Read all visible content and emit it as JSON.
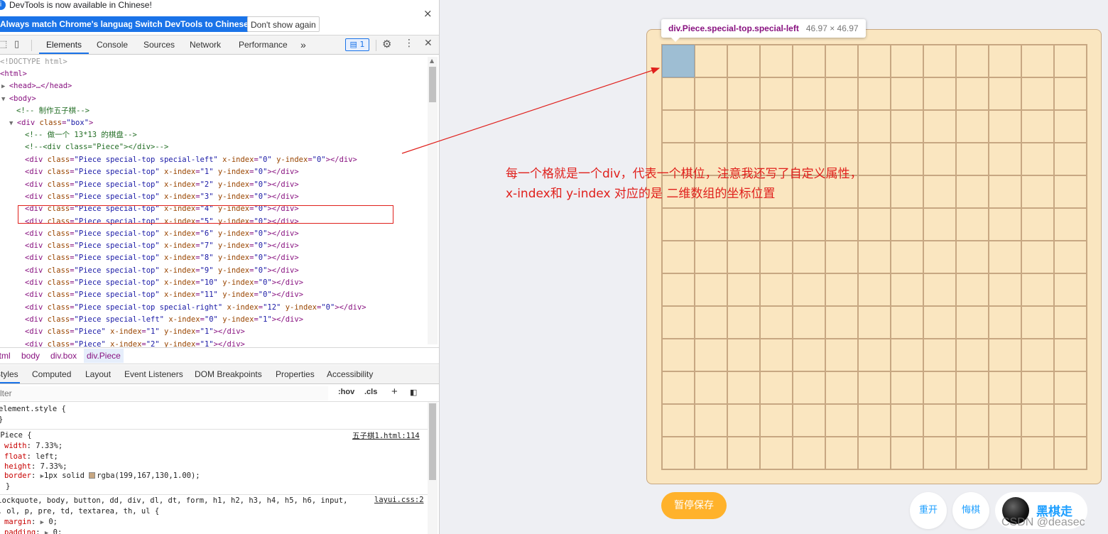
{
  "devtools": {
    "infobar": {
      "message": "DevTools is now available in Chinese!",
      "btn_match": "Always match Chrome's language",
      "btn_switch": "Switch DevTools to Chinese",
      "btn_dont_show": "Don't show again",
      "close": "×"
    },
    "tabs": [
      "Elements",
      "Console",
      "Sources",
      "Network",
      "Performance"
    ],
    "more_tabs": "»",
    "issues_count": "1",
    "dom": {
      "doctype": "<!DOCTYPE html>",
      "html_open": "<html>",
      "head": "<head>…</head>",
      "body_open": "<body>",
      "comment_make": "<!-- 制作五子棋-->",
      "box_tag": "div",
      "box_attr": "class",
      "box_val": "\"box\"",
      "comment_board": "<!-- 做一个 13*13 的棋盘-->",
      "comment_piece": "<!--<div class=\"Piece\"></div>-->",
      "rows": [
        {
          "cls": "\"Piece special-top special-left\"",
          "x": "\"0\"",
          "y": "\"0\""
        },
        {
          "cls": "\"Piece special-top\"",
          "x": "\"1\"",
          "y": "\"0\""
        },
        {
          "cls": "\"Piece special-top\"",
          "x": "\"2\"",
          "y": "\"0\""
        },
        {
          "cls": "\"Piece special-top\"",
          "x": "\"3\"",
          "y": "\"0\""
        },
        {
          "cls": "\"Piece special-top\"",
          "x": "\"4\"",
          "y": "\"0\""
        },
        {
          "cls": "\"Piece special-top\"",
          "x": "\"5\"",
          "y": "\"0\""
        },
        {
          "cls": "\"Piece special-top\"",
          "x": "\"6\"",
          "y": "\"0\""
        },
        {
          "cls": "\"Piece special-top\"",
          "x": "\"7\"",
          "y": "\"0\""
        },
        {
          "cls": "\"Piece special-top\"",
          "x": "\"8\"",
          "y": "\"0\""
        },
        {
          "cls": "\"Piece special-top\"",
          "x": "\"9\"",
          "y": "\"0\""
        },
        {
          "cls": "\"Piece special-top\"",
          "x": "\"10\"",
          "y": "\"0\""
        },
        {
          "cls": "\"Piece special-top\"",
          "x": "\"11\"",
          "y": "\"0\""
        },
        {
          "cls": "\"Piece special-top special-right\"",
          "x": "\"12\"",
          "y": "\"0\""
        },
        {
          "cls": "\"Piece special-left\"",
          "x": "\"0\"",
          "y": "\"1\""
        },
        {
          "cls": "\"Piece\"",
          "x": "\"1\"",
          "y": "\"1\""
        },
        {
          "cls": "\"Piece\"",
          "x": "\"2\"",
          "y": "\"1\""
        }
      ]
    },
    "breadcrumbs": [
      "html",
      "body",
      "div.box",
      "div.Piece"
    ],
    "subtabs": [
      "Styles",
      "Computed",
      "Layout",
      "Event Listeners",
      "DOM Breakpoints",
      "Properties",
      "Accessibility"
    ],
    "filter_placeholder": "Filter",
    "hov": ":hov",
    "cls": ".cls",
    "plus": "+",
    "styles": {
      "element_style": "element.style {",
      "piece_selector": ".Piece {",
      "piece_source": "五子棋1.html:114",
      "props": [
        {
          "name": "width",
          "value": "7.33%;"
        },
        {
          "name": "float",
          "value": "left;"
        },
        {
          "name": "height",
          "value": "7.33%;"
        }
      ],
      "border_prop": "border",
      "border_value": "1px solid ",
      "border_color_text": "rgba(199,167,130,1.00);",
      "border_color": "#c7a782",
      "reset_selector_1": "blockquote, body, button, dd, div, dl, dt, form, h1, h2, h3, h4, h5, h6, input,",
      "reset_selector_2": "li, ol, p, pre, td, textarea, th, ul {",
      "reset_source": "layui.css:2",
      "margin_prop": "margin",
      "margin_val": "0;",
      "padding_prop": "padding",
      "padding_val": "0;"
    }
  },
  "page": {
    "tooltip_selector": "div.Piece.special-top.special-left",
    "tooltip_size": "46.97 × 46.97",
    "annotation_line1": "每一个格就是一个div，代表一个棋位，注意我还写了自定义属性，",
    "annotation_line2": "x-index和 y-index 对应的是 二维数组的坐标位置",
    "board_cells": 13,
    "save_btn": "暂停保存",
    "restart_btn": "重开",
    "undo_btn": "悔棋",
    "turn_label": "黑棋走",
    "watermark": "CSDN @deasec",
    "colors": {
      "board": "#fae6c0",
      "grid_line": "#c7a782",
      "highlight": "#e0201c",
      "save": "#ffb22b",
      "accent": "#1e9fff"
    }
  }
}
